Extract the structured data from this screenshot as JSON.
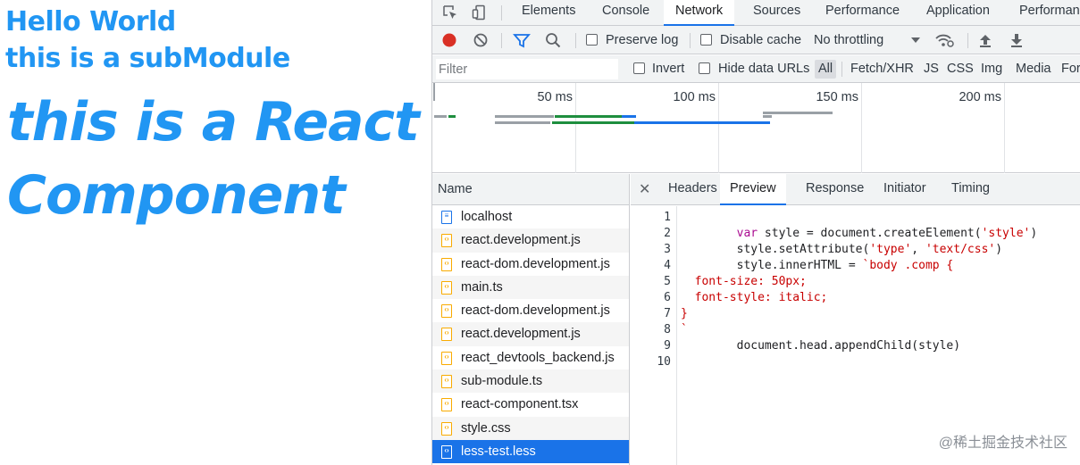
{
  "page": {
    "hello": "Hello World",
    "sub": "this is a subModule",
    "react": "this is a React Component"
  },
  "devtools": {
    "tabs": [
      "Elements",
      "Console",
      "Network",
      "Sources",
      "Performance",
      "Application",
      "Performan"
    ],
    "active_tab": "Network",
    "toolbar": {
      "preserve_log": "Preserve log",
      "disable_cache": "Disable cache",
      "throttling": "No throttling"
    },
    "filter": {
      "placeholder": "Filter",
      "invert": "Invert",
      "hide_data_urls": "Hide data URLs",
      "types": [
        "All",
        "Fetch/XHR",
        "JS",
        "CSS",
        "Img",
        "Media",
        "For"
      ]
    },
    "timeline": {
      "ticks": [
        "50 ms",
        "100 ms",
        "150 ms",
        "200 ms"
      ]
    },
    "list": {
      "header": "Name",
      "items": [
        {
          "name": "localhost",
          "kind": "doc"
        },
        {
          "name": "react.development.js",
          "kind": "script"
        },
        {
          "name": "react-dom.development.js",
          "kind": "script"
        },
        {
          "name": "main.ts",
          "kind": "script"
        },
        {
          "name": "react-dom.development.js",
          "kind": "script"
        },
        {
          "name": "react.development.js",
          "kind": "script"
        },
        {
          "name": "react_devtools_backend.js",
          "kind": "script"
        },
        {
          "name": "sub-module.ts",
          "kind": "script"
        },
        {
          "name": "react-component.tsx",
          "kind": "script"
        },
        {
          "name": "style.css",
          "kind": "script"
        },
        {
          "name": "less-test.less",
          "kind": "script"
        }
      ],
      "selected": "less-test.less"
    },
    "preview": {
      "tabs": [
        "Headers",
        "Preview",
        "Response",
        "Initiator",
        "Timing"
      ],
      "active_tab": "Preview",
      "line_numbers": [
        "1",
        "2",
        "3",
        "4",
        "5",
        "6",
        "7",
        "8",
        "9",
        "10"
      ]
    }
  },
  "watermark": "@稀土掘金技术社区",
  "colors": {
    "page_text": "#2196f3",
    "accent": "#1a73e8",
    "record": "#d93025"
  }
}
